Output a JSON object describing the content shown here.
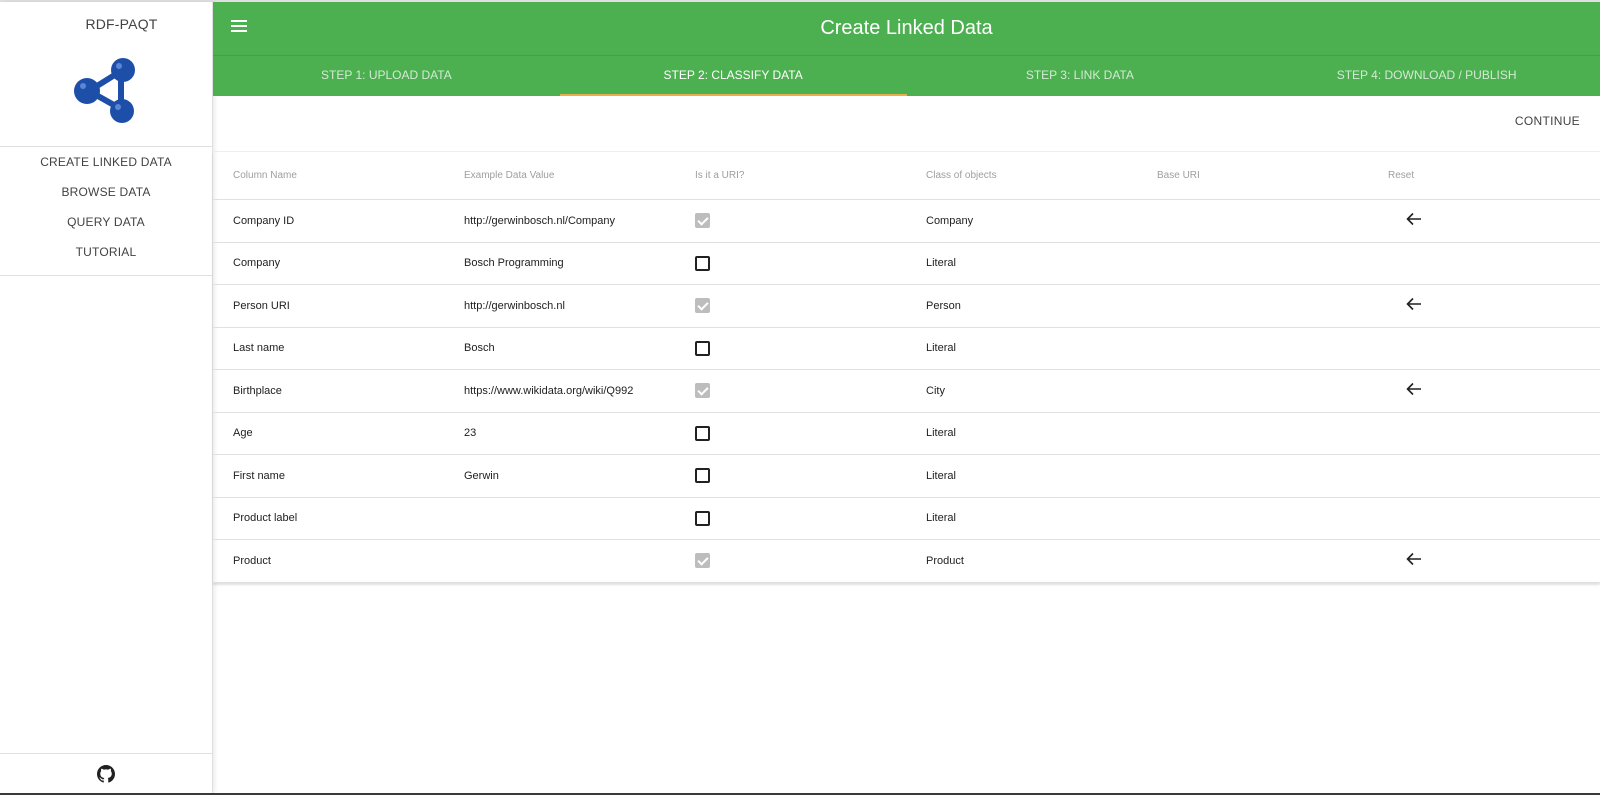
{
  "sidebar": {
    "brand": "RDF-PAQT",
    "logo_color": "#1e4fa8",
    "nav": [
      {
        "label": "CREATE LINKED DATA"
      },
      {
        "label": "BROWSE DATA"
      },
      {
        "label": "QUERY DATA"
      },
      {
        "label": "TUTORIAL"
      }
    ],
    "footer_icon": "github-icon"
  },
  "appbar": {
    "title": "Create Linked Data",
    "menu_icon": "hamburger-menu-icon",
    "color": "#4caf50"
  },
  "tabs": [
    {
      "label": "STEP 1: UPLOAD DATA",
      "active": false
    },
    {
      "label": "STEP 2: CLASSIFY DATA",
      "active": true
    },
    {
      "label": "STEP 3: LINK DATA",
      "active": false
    },
    {
      "label": "STEP 4: DOWNLOAD / PUBLISH",
      "active": false
    }
  ],
  "toolbar": {
    "continue_label": "CONTINUE"
  },
  "table": {
    "headers": [
      "Column Name",
      "Example Data Value",
      "Is it a URI?",
      "Class of objects",
      "Base URI",
      "Reset"
    ],
    "rows": [
      {
        "column": "Company ID",
        "example": "http://gerwinbosch.nl/Company",
        "is_uri": true,
        "class": "Company",
        "base_uri": "",
        "reset": true
      },
      {
        "column": "Company",
        "example": "Bosch Programming",
        "is_uri": false,
        "class": "Literal",
        "base_uri": "",
        "reset": false
      },
      {
        "column": "Person URI",
        "example": "http://gerwinbosch.nl",
        "is_uri": true,
        "class": "Person",
        "base_uri": "",
        "reset": true
      },
      {
        "column": "Last name",
        "example": "Bosch",
        "is_uri": false,
        "class": "Literal",
        "base_uri": "",
        "reset": false
      },
      {
        "column": "Birthplace",
        "example": "https://www.wikidata.org/wiki/Q992",
        "is_uri": true,
        "class": "City",
        "base_uri": "",
        "reset": true
      },
      {
        "column": "Age",
        "example": "23",
        "is_uri": false,
        "class": "Literal",
        "base_uri": "",
        "reset": false
      },
      {
        "column": "First name",
        "example": "Gerwin",
        "is_uri": false,
        "class": "Literal",
        "base_uri": "",
        "reset": false
      },
      {
        "column": "Product label",
        "example": "",
        "is_uri": false,
        "class": "Literal",
        "base_uri": "",
        "reset": false
      },
      {
        "column": "Product",
        "example": "",
        "is_uri": true,
        "class": "Product",
        "base_uri": "",
        "reset": true
      }
    ]
  }
}
